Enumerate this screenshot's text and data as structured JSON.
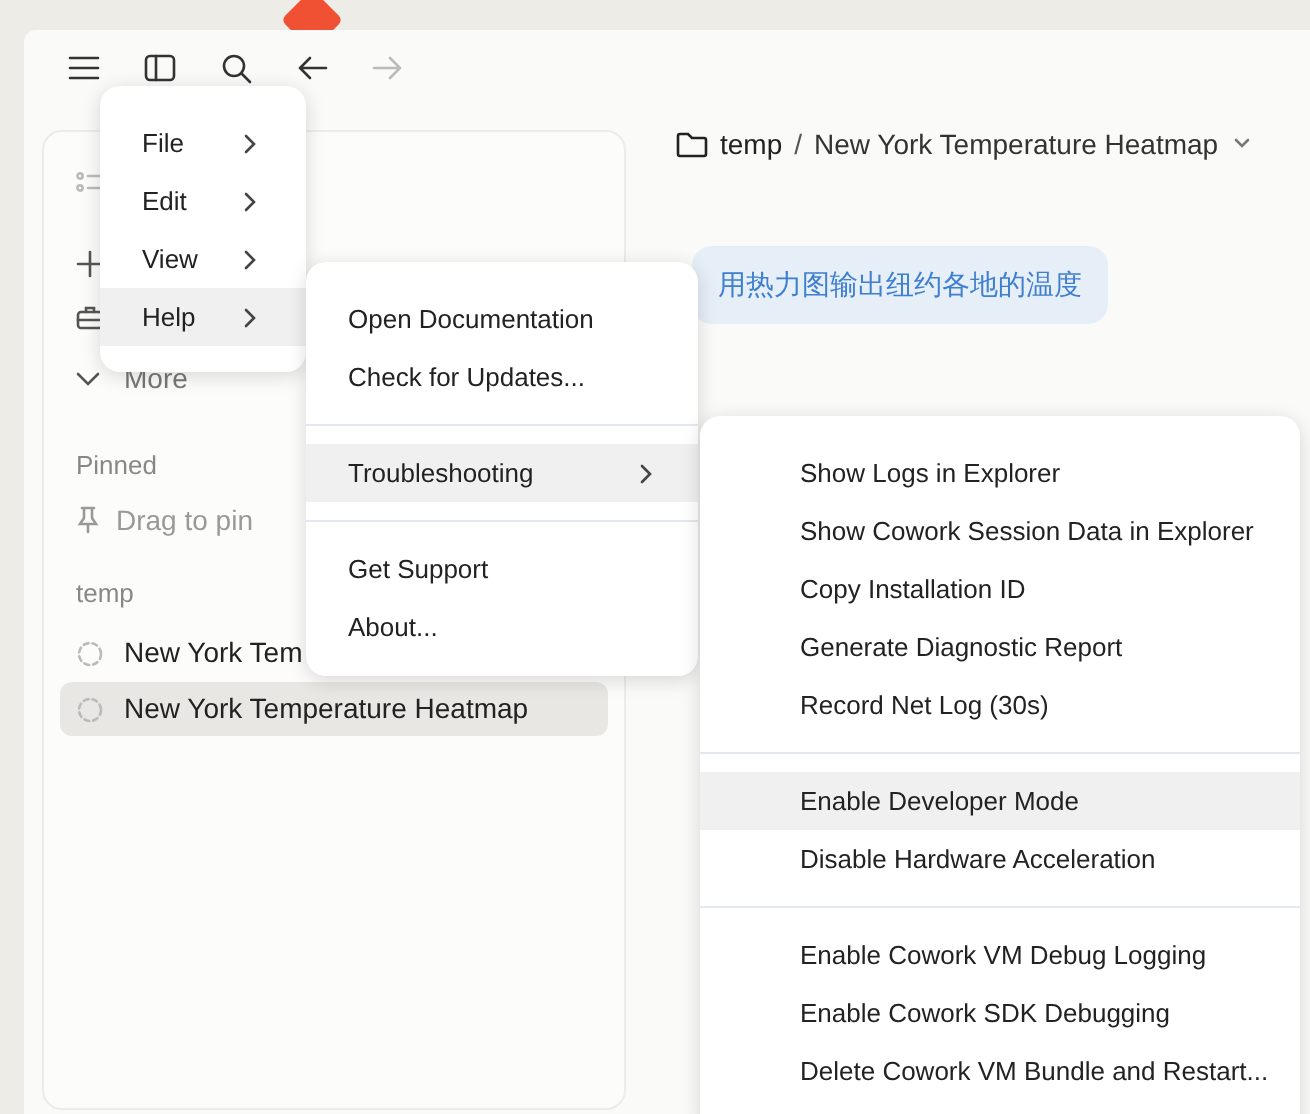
{
  "toolbar": [
    {
      "kind": "menu",
      "disabled": false
    },
    {
      "kind": "sidebar",
      "disabled": false
    },
    {
      "kind": "search",
      "disabled": false
    },
    {
      "kind": "back",
      "disabled": false
    },
    {
      "kind": "forward",
      "disabled": true
    }
  ],
  "sidebar": {
    "actions": [
      {
        "kind": "list"
      },
      {
        "kind": "plus"
      },
      {
        "kind": "briefcase"
      },
      {
        "kind": "chevron",
        "label": "More"
      }
    ],
    "pinned": {
      "heading": "Pinned",
      "hint": "Drag to pin"
    },
    "group": {
      "heading": "temp",
      "items": [
        {
          "label": "New York Tem",
          "selected": false
        },
        {
          "label": "New York Temperature Heatmap",
          "selected": true
        }
      ]
    }
  },
  "header": {
    "folder": "temp",
    "separator": "/",
    "title": "New York Temperature Heatmap"
  },
  "message": "用热力图输出纽约各地的温度",
  "menu": [
    {
      "label": "File",
      "selected": false
    },
    {
      "label": "Edit",
      "selected": false
    },
    {
      "label": "View",
      "selected": false
    },
    {
      "label": "Help",
      "selected": true
    }
  ],
  "help_menu": [
    {
      "kind": "item",
      "label": "Open Documentation",
      "selected": false
    },
    {
      "kind": "item",
      "label": "Check for Updates...",
      "selected": false
    },
    {
      "kind": "separator"
    },
    {
      "kind": "submenu",
      "label": "Troubleshooting",
      "selected": true
    },
    {
      "kind": "separator"
    },
    {
      "kind": "item",
      "label": "Get Support",
      "selected": false
    },
    {
      "kind": "item",
      "label": "About...",
      "selected": false
    }
  ],
  "troubleshooting_menu": [
    {
      "kind": "item",
      "label": "Show Logs in Explorer",
      "selected": false
    },
    {
      "kind": "item",
      "label": "Show Cowork Session Data in Explorer",
      "selected": false
    },
    {
      "kind": "item",
      "label": "Copy Installation ID",
      "selected": false
    },
    {
      "kind": "item",
      "label": "Generate Diagnostic Report",
      "selected": false
    },
    {
      "kind": "item",
      "label": "Record Net Log (30s)",
      "selected": false
    },
    {
      "kind": "separator"
    },
    {
      "kind": "item",
      "label": "Enable Developer Mode",
      "selected": true
    },
    {
      "kind": "item",
      "label": "Disable Hardware Acceleration",
      "selected": false
    },
    {
      "kind": "separator"
    },
    {
      "kind": "item",
      "label": "Enable Cowork VM Debug Logging",
      "selected": false
    },
    {
      "kind": "item",
      "label": "Enable Cowork SDK Debugging",
      "selected": false
    },
    {
      "kind": "item",
      "label": "Delete Cowork VM Bundle and Restart...",
      "selected": false
    }
  ]
}
